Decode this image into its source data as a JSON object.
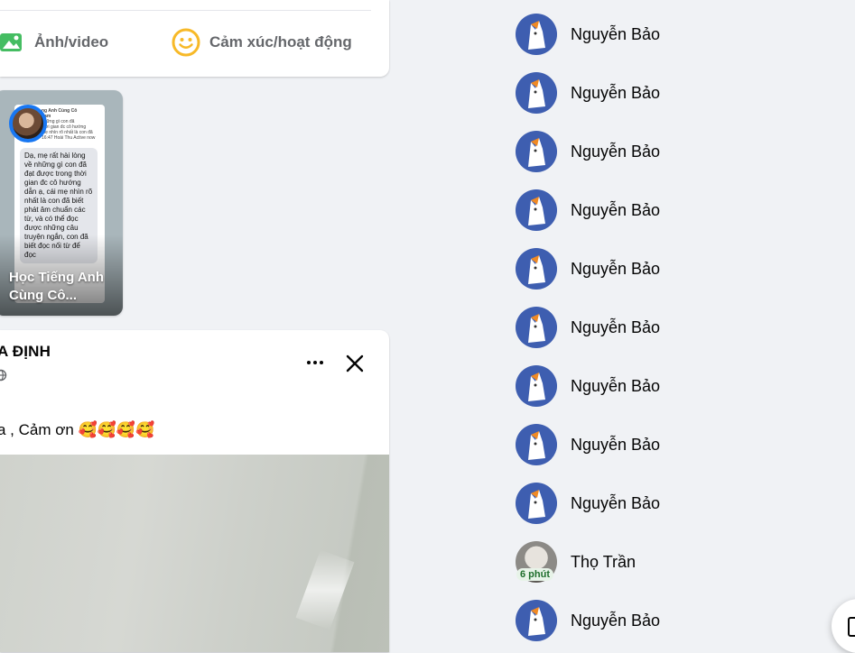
{
  "composer": {
    "photo_label": "Ảnh/video",
    "feeling_label": "Cảm xúc/hoạt động",
    "icons": {
      "photo": "photo-icon",
      "feeling": "smile-icon"
    },
    "colors": {
      "photo": "#45bd62",
      "feeling": "#f7b928"
    }
  },
  "story": {
    "title": "Học Tiếng Anh Cùng Cô...",
    "screenshot_heading": "ng Anh Cùng Cô",
    "screenshot_heading_sub": "ham",
    "screenshot_lines": [
      "những gì con đã",
      "thời gian đc cô hướng",
      "mẹ nhìn rõ nhất là con đã"
    ],
    "screenshot_time": "16:47",
    "screenshot_contact": "Hoài Thu",
    "screenshot_contact_status": "Active now",
    "message": "Dạ, mẹ rất hài lòng về những gì con đã đạt được trong thời gian đc cô hướng dẫn ạ, cái mẹ nhìn rõ nhất là con đã biết phát âm chuẩn các từ, và có thể đọc được những câu truyện ngắn, con đã biết đọc nối từ để đọc"
  },
  "post": {
    "author": "A ĐỊNH",
    "privacy_icon": "globe-icon",
    "text": "a , Cảm ơn 🥰🥰🥰🥰"
  },
  "contacts": [
    {
      "name": "Nguyễn Bảo",
      "avatar": "fox-avatar"
    },
    {
      "name": "Nguyễn Bảo",
      "avatar": "fox-avatar"
    },
    {
      "name": "Nguyễn Bảo",
      "avatar": "fox-avatar"
    },
    {
      "name": "Nguyễn Bảo",
      "avatar": "fox-avatar"
    },
    {
      "name": "Nguyễn Bảo",
      "avatar": "fox-avatar"
    },
    {
      "name": "Nguyễn Bảo",
      "avatar": "fox-avatar"
    },
    {
      "name": "Nguyễn Bảo",
      "avatar": "fox-avatar"
    },
    {
      "name": "Nguyễn Bảo",
      "avatar": "fox-avatar"
    },
    {
      "name": "Nguyễn Bảo",
      "avatar": "fox-avatar"
    },
    {
      "name": "Thọ Trần",
      "avatar": "photo-avatar",
      "badge": "6 phút"
    },
    {
      "name": "Nguyễn Bảo",
      "avatar": "fox-avatar"
    }
  ],
  "floating_button": {
    "icon": "new-message-icon"
  }
}
